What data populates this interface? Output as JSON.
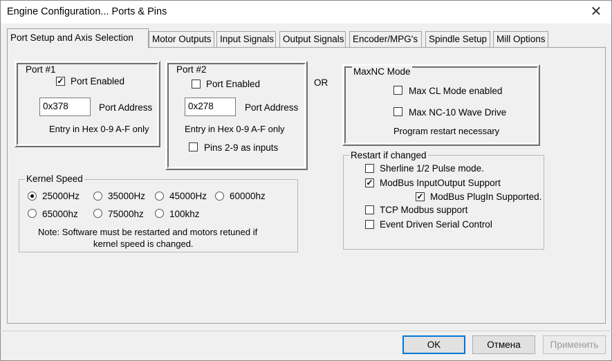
{
  "window": {
    "title": "Engine Configuration... Ports & Pins",
    "close_glyph": "✕"
  },
  "tabs": [
    {
      "label": "Port Setup and Axis Selection",
      "active": true
    },
    {
      "label": "Motor Outputs"
    },
    {
      "label": "Input Signals"
    },
    {
      "label": "Output Signals"
    },
    {
      "label": "Encoder/MPG's"
    },
    {
      "label": "Spindle Setup"
    },
    {
      "label": "Mill Options"
    }
  ],
  "port1": {
    "title": "Port #1",
    "enabled_label": "Port Enabled",
    "enabled": true,
    "address": "0x378",
    "address_label": "Port Address",
    "hint": "Entry in Hex 0-9 A-F only"
  },
  "port2": {
    "title": "Port #2",
    "enabled_label": "Port Enabled",
    "enabled": false,
    "address": "0x278",
    "address_label": "Port Address",
    "hint": "Entry in Hex 0-9 A-F only",
    "pins_label": "Pins 2-9 as inputs",
    "pins": false
  },
  "or_label": "OR",
  "maxnc": {
    "title": "MaxNC Mode",
    "cl_label": "Max CL Mode enabled",
    "cl": false,
    "wave_label": "Max NC-10 Wave Drive",
    "wave": false,
    "note": "Program restart necessary"
  },
  "restart": {
    "title": "Restart if changed",
    "items": [
      {
        "label": "Sherline 1/2 Pulse mode.",
        "checked": false
      },
      {
        "label": "ModBus InputOutput Support",
        "checked": true
      },
      {
        "label": "ModBus PlugIn Supported.",
        "checked": true
      },
      {
        "label": "TCP Modbus support",
        "checked": false
      },
      {
        "label": "Event Driven Serial Control",
        "checked": false
      }
    ]
  },
  "kernel": {
    "title": "Kernel Speed",
    "options": [
      "25000Hz",
      "35000Hz",
      "45000Hz",
      "60000hz",
      "65000hz",
      "75000hz",
      "100khz"
    ],
    "selected": "25000Hz",
    "note_line1": "Note: Software must be restarted and motors retuned if",
    "note_line2": "kernel speed is changed."
  },
  "buttons": {
    "ok": "OK",
    "cancel": "Отмена",
    "apply": "Применить"
  },
  "colors": {
    "accent": "#0078d7",
    "background": "#f0f0f0"
  }
}
